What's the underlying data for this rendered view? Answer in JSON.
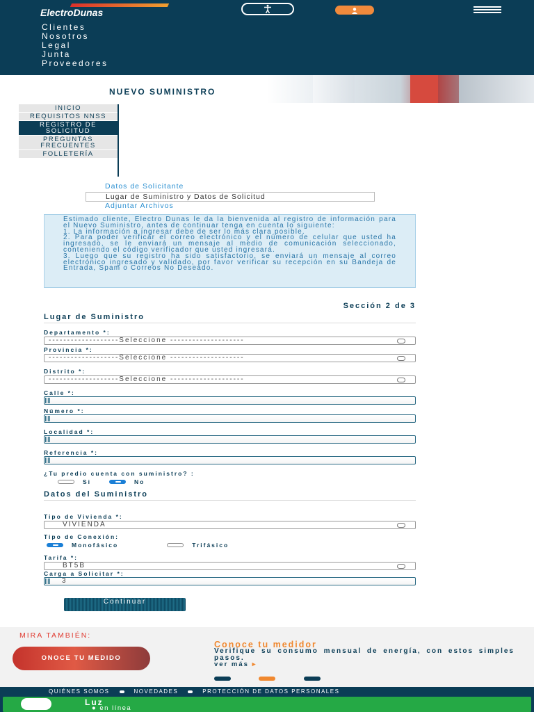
{
  "header": {
    "logo_text": "ElectroDunas",
    "nav": [
      "Clientes",
      "Nosotros",
      "Legal",
      "Junta",
      "Proveedores"
    ]
  },
  "banner": {
    "title": "NUEVO SUMINISTRO"
  },
  "sidebar": {
    "items": [
      "INICIO",
      "REQUISITOS NNSS",
      "REGISTRO DE SOLICITUD",
      "PREGUNTAS FRECUENTES",
      "FOLLETERÍA"
    ]
  },
  "steps": [
    "Datos de Solicitante",
    "Lugar de Suministro y Datos de Solicitud",
    "Adjuntar Archivos"
  ],
  "info": {
    "intro": "Estimado cliente, Electro Dunas le da la bienvenida al registro de información para el Nuevo Suministro, antes de continuar tenga en cuenta lo siguiente:",
    "item1": "1. La información a ingresar debe de ser lo más clara posible.",
    "item2": "2. Para poder verificar el correo electrónico y el número de celular que usted ha ingresado, se le enviará un mensaje al medio de comunicación seleccionado, conteniendo el código verificador que usted ingresará.",
    "item3": "3. Luego que su registro ha sido satisfactorio, se enviará un mensaje al correo electrónico ingresado y validado, por favor verificar su recepción en su Bandeja de Entrada, Spam o Correos No Deseado."
  },
  "form": {
    "section_counter": "Sección 2 de 3",
    "lugar_title": "Lugar de Suministro",
    "departamento_label": "Departamento *:",
    "provincia_label": "Provincia *:",
    "distrito_label": "Distrito *:",
    "select_placeholder": "-------------------Seleccione --------------------",
    "calle_label": "Calle *:",
    "numero_label": "Número *:",
    "localidad_label": "Localidad *:",
    "referencia_label": "Referencia *:",
    "predio_question": "¿Tu predio cuenta con suministro? :",
    "predio_si": "Si",
    "predio_no": "No",
    "datos_title": "Datos del Suministro",
    "tipo_vivienda_label": "Tipo de Vivienda *:",
    "tipo_vivienda_value": "VIVIENDA",
    "tipo_conexion_label": "Tipo de Conexión:",
    "monofasico": "Monofásico",
    "trifasico": "Trifásico",
    "tarifa_label": "Tarifa *:",
    "tarifa_value": "BT5B",
    "carga_label": "Carga a Solicitar *:",
    "carga_value": "3",
    "continue_label": "Continuar"
  },
  "mira": {
    "title": "MIRA TAMBIÉN:",
    "promo_image_text": "ONOCE TU MEDIDO",
    "promo_title": "Conoce tu medidor",
    "promo_text": "Verifique su consumo mensual de energía, con estos simples pasos.",
    "promo_link": "ver más"
  },
  "colors": {
    "brand": "#0b3d56",
    "accent": "#f0882f",
    "chat": "#25a945",
    "info_bg": "#dcedf6"
  },
  "footer": {
    "links": [
      "QUIÉNES SOMOS",
      "NOVEDADES",
      "PROTECCIÓN DE DATOS PERSONALES"
    ],
    "chat_name": "Luz",
    "chat_status": "en línea"
  }
}
